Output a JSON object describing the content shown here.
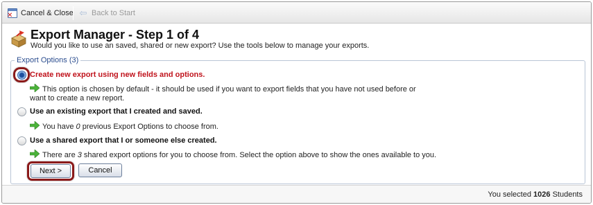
{
  "toolbar": {
    "cancel_close_label": "Cancel & Close",
    "back_to_start_label": "Back to Start"
  },
  "header": {
    "title": "Export Manager - Step 1 of 4",
    "subtitle": "Would you like to use an saved, shared or new export? Use the tools below to manage your exports."
  },
  "export_options": {
    "legend": "Export Options (3)",
    "options": [
      {
        "label": "Create new export using new fields and options.",
        "selected": true,
        "description": "This option is chosen by default - it should be used if you want to export fields that you have not used before or want to create a new report."
      },
      {
        "label": "Use an existing export that I created and saved.",
        "selected": false,
        "desc_before": "You have ",
        "desc_count": "0",
        "desc_after": " previous Export Options to choose from."
      },
      {
        "label": "Use a shared export that I or someone else created.",
        "selected": false,
        "desc_before": "There are ",
        "desc_count": "3",
        "desc_after": " shared export options for you to choose from. Select the option above to show the ones available to you."
      }
    ]
  },
  "buttons": {
    "next_label": "Next >",
    "cancel_label": "Cancel"
  },
  "footer": {
    "prefix": "You selected ",
    "count": "1026",
    "suffix": " Students"
  },
  "colors": {
    "selected_option_text": "#c0131c",
    "highlight_ring": "#8b1a1a",
    "legend_text": "#2a4c8e",
    "arrow_green": "#4bb33a"
  }
}
